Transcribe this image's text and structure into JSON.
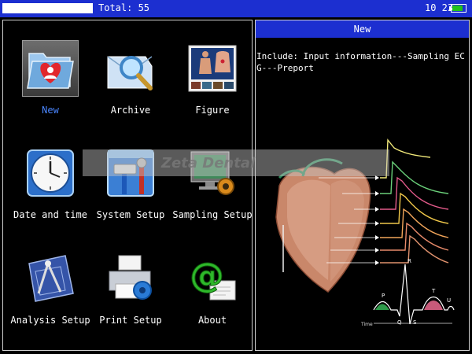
{
  "statusbar": {
    "total_label": "Total: 55",
    "clock": "10 23",
    "progress": 1.0
  },
  "menu": {
    "items": [
      {
        "label": "New",
        "icon": "new-record-folder-icon",
        "selected": true
      },
      {
        "label": "Archive",
        "icon": "archive-search-icon",
        "selected": false
      },
      {
        "label": "Figure",
        "icon": "anatomy-figure-icon",
        "selected": false
      },
      {
        "label": "Date and time",
        "icon": "clock-icon",
        "selected": false
      },
      {
        "label": "System Setup",
        "icon": "tools-icon",
        "selected": false
      },
      {
        "label": "Sampling Setup",
        "icon": "monitor-gear-icon",
        "selected": false
      },
      {
        "label": "Analysis Setup",
        "icon": "drafting-compass-icon",
        "selected": false
      },
      {
        "label": "Print Setup",
        "icon": "printer-icon",
        "selected": false
      },
      {
        "label": "About",
        "icon": "at-sign-icon",
        "selected": false
      }
    ]
  },
  "detail": {
    "header": "New",
    "description": "Include: Input information---Sampling ECG---Preport"
  },
  "illustration": {
    "ecg_wave_labels": [
      "P",
      "Q",
      "R",
      "S",
      "T",
      "U"
    ],
    "time_label": "Time"
  },
  "watermark": "Zeta Dental",
  "colors": {
    "bar_blue": "#1c2fd0",
    "selected_label": "#4a86ff",
    "battery_green": "#21c21b"
  }
}
